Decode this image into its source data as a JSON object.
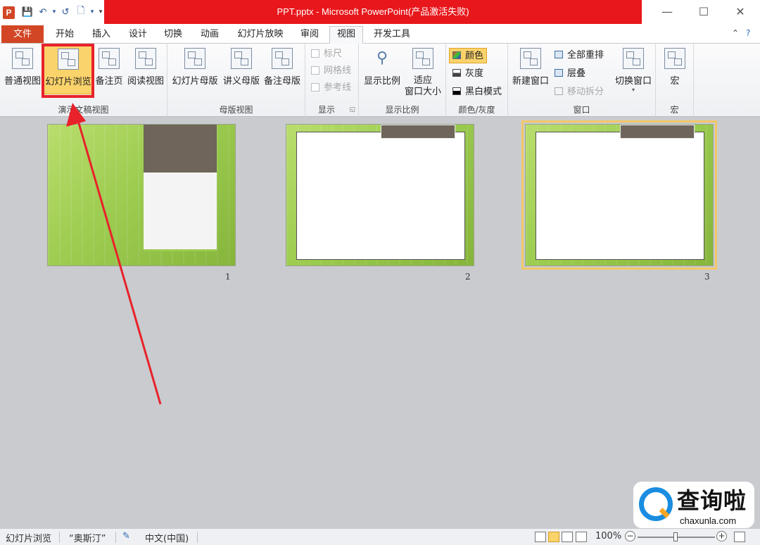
{
  "window": {
    "title": "PPT.pptx - Microsoft PowerPoint(产品激活失败)",
    "app_icon_letter": "P",
    "minimize": "—",
    "maximize": "☐",
    "close": "✕"
  },
  "tabs": {
    "file": "文件",
    "home": "开始",
    "insert": "插入",
    "design": "设计",
    "transitions": "切换",
    "animations": "动画",
    "slideshow": "幻灯片放映",
    "review": "审阅",
    "view": "视图",
    "developer": "开发工具"
  },
  "ribbon": {
    "presentation_views": {
      "label": "演示文稿视图",
      "normal": "普通视图",
      "slide_sorter": "幻灯片浏览",
      "notes_page": "备注页",
      "reading_view": "阅读视图"
    },
    "master_views": {
      "label": "母版视图",
      "slide_master": "幻灯片母版",
      "handout_master": "讲义母版",
      "notes_master": "备注母版"
    },
    "show": {
      "label": "显示",
      "ruler": "标尺",
      "gridlines": "网格线",
      "guides": "参考线"
    },
    "zoom": {
      "label": "显示比例",
      "zoom": "显示比例",
      "fit_line1": "适应",
      "fit_line2": "窗口大小"
    },
    "color": {
      "label": "颜色/灰度",
      "color": "颜色",
      "grayscale": "灰度",
      "bw": "黑白模式"
    },
    "window": {
      "label": "窗口",
      "new_window": "新建窗口",
      "arrange_all": "全部重排",
      "cascade": "层叠",
      "move_split": "移动拆分",
      "switch_windows": "切换窗口"
    },
    "macros": {
      "label": "宏",
      "macros": "宏"
    }
  },
  "slides": [
    {
      "number": "1"
    },
    {
      "number": "2"
    },
    {
      "number": "3"
    }
  ],
  "watermark": {
    "cn": "查询啦",
    "en": "chaxunla.com"
  },
  "statusbar": {
    "view_name": "幻灯片浏览",
    "theme": "“奥斯汀”",
    "language": "中文(中国)",
    "zoom": "100%"
  },
  "colors": {
    "file_tab": "#d24625",
    "title_highlight": "#e8171b",
    "selected_button": "#fbd36b",
    "annotation_red": "#e8222a",
    "slide_green": "#9ccc50"
  }
}
